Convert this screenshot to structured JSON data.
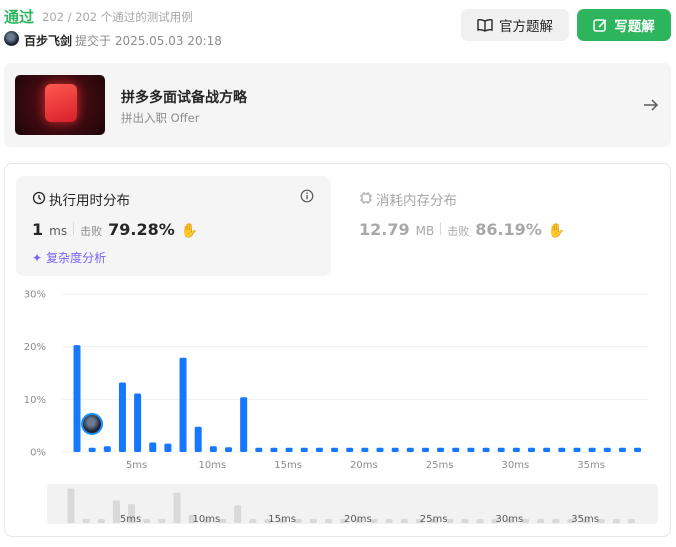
{
  "header": {
    "status": "通过",
    "cases": "202 / 202 个通过的测试用例",
    "user": "百步飞剑",
    "submitted": "提交于 2025.05.03 20:18",
    "btn_official": "官方题解",
    "btn_write": "写题解"
  },
  "promo": {
    "title": "拼多多面试备战方略",
    "subtitle": "拼出入职 Offer"
  },
  "runtime": {
    "tab_label": "执行用时分布",
    "value": "1",
    "unit": "ms",
    "beat_label": "击败",
    "beat": "79.28%",
    "complexity": "复杂度分析"
  },
  "memory": {
    "tab_label": "消耗内存分布",
    "value": "12.79",
    "unit": "MB",
    "beat_label": "击败",
    "beat": "86.19%"
  },
  "colors": {
    "accent_green": "#2db55d",
    "bar_blue": "#1677ff",
    "purple": "#7b61ff"
  },
  "chart_data": {
    "type": "bar",
    "xlabel": "",
    "ylabel": "",
    "ylim": [
      0,
      30
    ],
    "y_ticks": [
      "30%",
      "20%",
      "10%",
      "0%"
    ],
    "x_ticks": [
      "5ms",
      "10ms",
      "15ms",
      "20ms",
      "25ms",
      "30ms",
      "35ms"
    ],
    "x_tick_values": [
      5,
      10,
      15,
      20,
      25,
      30,
      35
    ],
    "x": [
      1,
      2,
      3,
      4,
      5,
      6,
      7,
      8,
      9,
      10,
      11,
      12,
      13,
      14,
      15,
      16,
      17,
      18,
      19,
      20,
      21,
      22,
      23,
      24,
      25,
      26,
      27,
      28,
      29,
      30,
      31,
      32,
      33,
      34,
      35,
      36,
      37,
      38
    ],
    "values": [
      20.3,
      0.8,
      1.1,
      13.2,
      11.1,
      1.8,
      1.6,
      17.9,
      4.8,
      1.1,
      0.9,
      10.4,
      0.8,
      0.8,
      0.8,
      0.8,
      0.8,
      0.8,
      0.8,
      0.8,
      0.8,
      0.8,
      0.8,
      0.8,
      0.8,
      0.8,
      0.8,
      0.8,
      0.8,
      0.8,
      0.8,
      0.8,
      0.8,
      0.8,
      0.8,
      0.8,
      0.8,
      0.8
    ],
    "highlight_x": 2
  }
}
